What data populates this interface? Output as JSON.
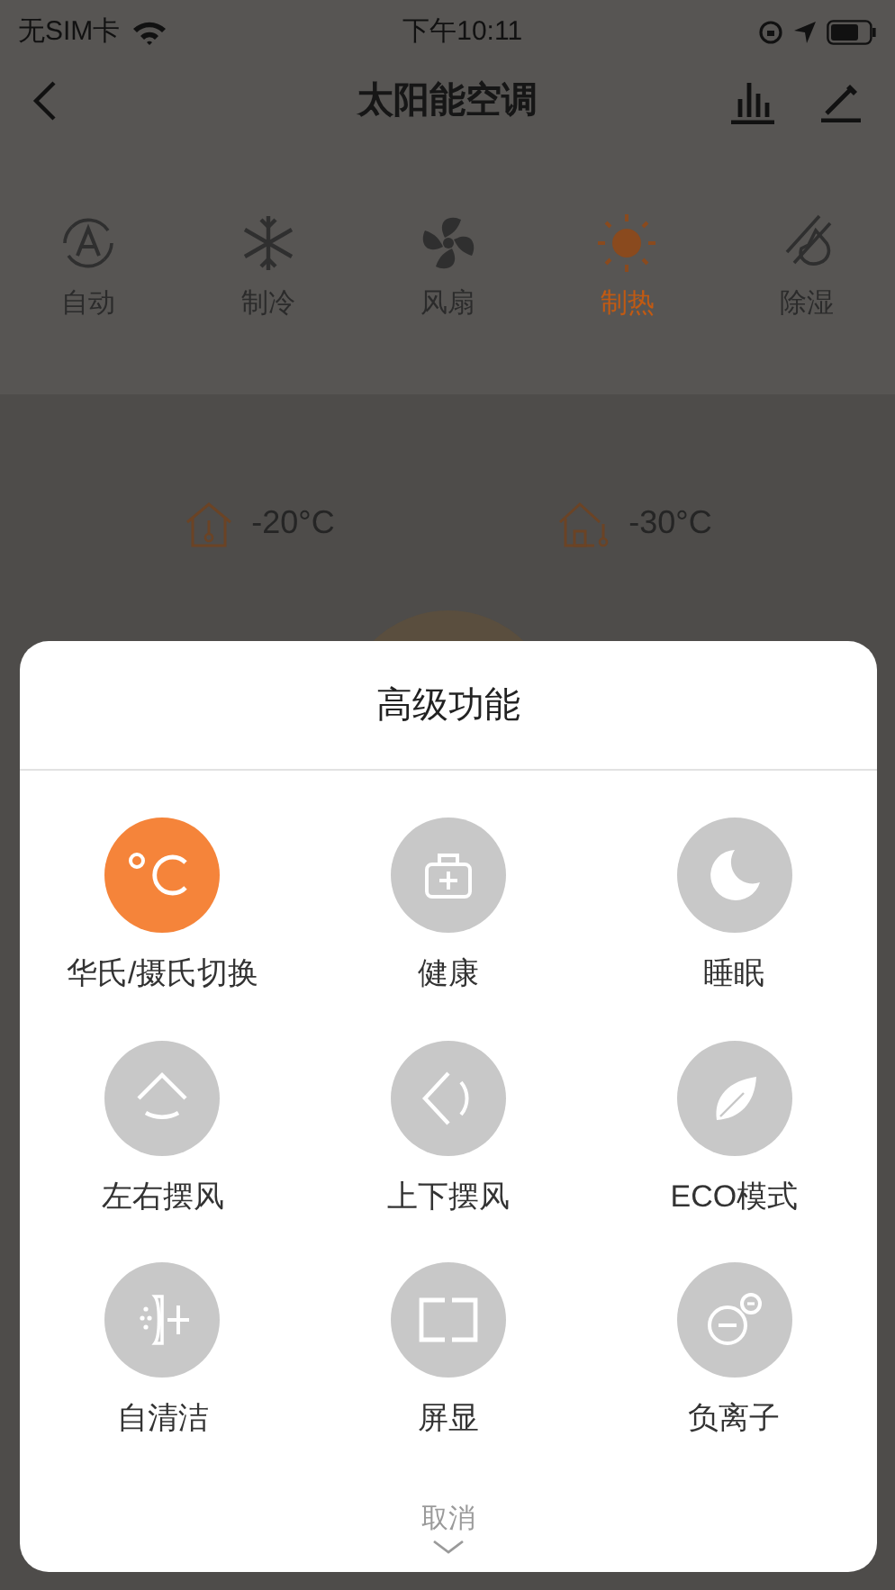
{
  "status_bar": {
    "carrier": "无SIM卡",
    "time": "下午10:11"
  },
  "header": {
    "title": "太阳能空调"
  },
  "modes": [
    {
      "label": "自动",
      "selected": false
    },
    {
      "label": "制冷",
      "selected": false
    },
    {
      "label": "风扇",
      "selected": false
    },
    {
      "label": "制热",
      "selected": true
    },
    {
      "label": "除湿",
      "selected": false
    }
  ],
  "temperatures": [
    {
      "kind": "indoor",
      "value": "-20°C"
    },
    {
      "kind": "outdoor",
      "value": "-30°C"
    }
  ],
  "sheet": {
    "title": "高级功能",
    "features": [
      {
        "label": "华氏/摄氏切换",
        "on": true
      },
      {
        "label": "健康",
        "on": false
      },
      {
        "label": "睡眠",
        "on": false
      },
      {
        "label": "左右摆风",
        "on": false
      },
      {
        "label": "上下摆风",
        "on": false
      },
      {
        "label": "ECO模式",
        "on": false
      },
      {
        "label": "自清洁",
        "on": false
      },
      {
        "label": "屏显",
        "on": false
      },
      {
        "label": "负离子",
        "on": false
      }
    ],
    "cancel": "取消"
  }
}
